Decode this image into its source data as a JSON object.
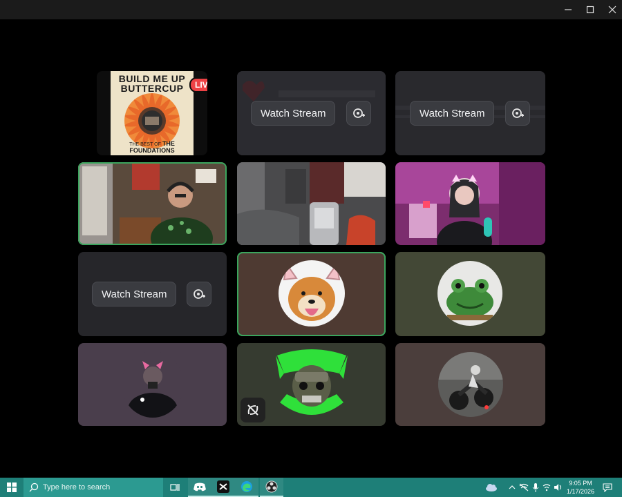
{
  "window": {
    "controls": [
      "minimize",
      "maximize",
      "close"
    ]
  },
  "tiles": {
    "album": {
      "title_line1": "BUILD ME UP",
      "title_line2": "BUTTERCUP",
      "subtitle": "THE BEST OF",
      "artist": "THE FOUNDATIONS",
      "live_label": "LIVE"
    },
    "stream_a": {
      "watch_label": "Watch Stream"
    },
    "stream_b": {
      "watch_label": "Watch Stream"
    },
    "stream_c": {
      "watch_label": "Watch Stream"
    }
  },
  "taskbar": {
    "search_placeholder": "Type here to search",
    "time": "9:05 PM",
    "date": "1/17/2026",
    "apps": [
      "task-view",
      "discord",
      "capcut",
      "edge",
      "obs"
    ]
  },
  "colors": {
    "speaking_ring": "#3ba55d",
    "live_badge": "#ed4245",
    "taskbar": "#1e7f78",
    "tile_bg": "#26262a"
  }
}
